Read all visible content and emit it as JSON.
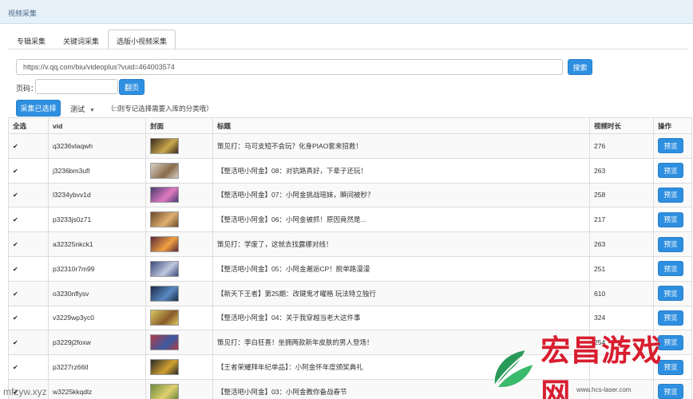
{
  "titlebar": {
    "title": "视频采集"
  },
  "tabs": [
    {
      "label": "专辑采集",
      "active": false
    },
    {
      "label": "关键词采集",
      "active": false
    },
    {
      "label": "选版小视频采集",
      "active": true
    }
  ],
  "url_input": {
    "value": "https://v.qq.com/biu/videoplus?vuid=464003574"
  },
  "search_button": {
    "label": "搜索"
  },
  "page": {
    "label": "页码：",
    "value": "",
    "button_label": "翻页"
  },
  "toolbar": {
    "collect_label": "采集已选择",
    "category_value": "测试",
    "hint": "（□则专记选择需要入库的分类哦）"
  },
  "table": {
    "headers": [
      "全选",
      "vid",
      "封面",
      "标题",
      "视频时长",
      "操作"
    ],
    "rows": [
      {
        "checked": true,
        "vid": "q3236vlaqwh",
        "title": "策见打：马可支短不会玩？化身PIAO套来招救！",
        "duration": "276",
        "action": "预览",
        "thumb_colors": [
          "#3a2a22",
          "#c9a84a"
        ]
      },
      {
        "checked": true,
        "vid": "j3236bm3ufl",
        "title": "【整活吧小阿金】08：对抗路真好，下辈子还玩！",
        "duration": "263",
        "action": "预览",
        "thumb_colors": [
          "#d8d0c4",
          "#8a6a4c"
        ]
      },
      {
        "checked": true,
        "vid": "l3234ybvv1d",
        "title": "【整活吧小阿金】07：小阿金挑战瑶妹，瞬间被秒？",
        "duration": "258",
        "action": "预览",
        "thumb_colors": [
          "#4a3a72",
          "#e07ac0"
        ]
      },
      {
        "checked": true,
        "vid": "p3233js0z71",
        "title": "【整活吧小阿金】06：小阿金被抓！原因竟然是...",
        "duration": "217",
        "action": "预览",
        "thumb_colors": [
          "#6a4a2a",
          "#e0b070"
        ]
      },
      {
        "checked": true,
        "vid": "a32325nkck1",
        "title": "策见打：学废了，这就去找露娜对线！",
        "duration": "263",
        "action": "预览",
        "thumb_colors": [
          "#5a2a3a",
          "#f0a040"
        ]
      },
      {
        "checked": true,
        "vid": "p32310r7m99",
        "title": "【整活吧小阿金】05：小阿金邂逅CP！脱单路漫漫",
        "duration": "251",
        "action": "预览",
        "thumb_colors": [
          "#3a4a7a",
          "#c0c8e0"
        ]
      },
      {
        "checked": true,
        "vid": "o3230nflysv",
        "title": "【新天下王者】第25期：改键鬼才曜格 玩法特立独行",
        "duration": "610",
        "action": "预览",
        "thumb_colors": [
          "#1a2a4a",
          "#5a8ac0"
        ]
      },
      {
        "checked": true,
        "vid": "v3229wp3yc0",
        "title": "【整活吧小阿金】04：关于我穿越当老大这件事",
        "duration": "324",
        "action": "预览",
        "thumb_colors": [
          "#d8c860",
          "#8a5a2a"
        ]
      },
      {
        "checked": true,
        "vid": "p3229j2foxw",
        "title": "策见打：李白狂喜！坐拥两款新年皮肤的男人登场！",
        "duration": "254",
        "action": "预览",
        "thumb_colors": [
          "#b03a4a",
          "#3a5aa0"
        ]
      },
      {
        "checked": true,
        "vid": "p3227rz66tl",
        "title": "【王者荣耀拜年纪单品】：小阿金怀年度颁奖典礼",
        "duration": "",
        "action": "预览",
        "thumb_colors": [
          "#2a2a2a",
          "#d0a030"
        ]
      },
      {
        "checked": true,
        "vid": "w3225kkqdlz",
        "title": "【整活吧小阿金】03：小阿金教你备战春节",
        "duration": "",
        "action": "预览",
        "thumb_colors": [
          "#6a8a3a",
          "#e0d070"
        ]
      }
    ]
  },
  "watermarks": {
    "url": "mfzyw.xyz",
    "brand": "宏昌游戏网",
    "brand_url": "www.hcs-laser.com"
  },
  "colors": {
    "accent": "#2e8fe0",
    "brand_red": "#d81e2f",
    "brand_green": "#2a9a5a"
  }
}
